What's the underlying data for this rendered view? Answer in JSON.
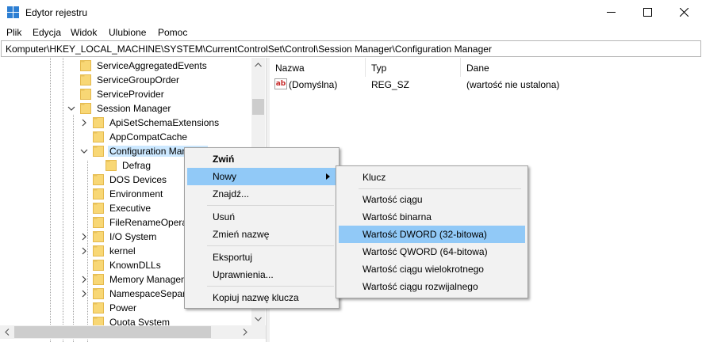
{
  "window": {
    "title": "Edytor rejestru",
    "controls": [
      "minimize",
      "maximize",
      "close"
    ]
  },
  "menubar": [
    "Plik",
    "Edycja",
    "Widok",
    "Ulubione",
    "Pomoc"
  ],
  "address": "Komputer\\HKEY_LOCAL_MACHINE\\SYSTEM\\CurrentControlSet\\Control\\Session Manager\\Configuration Manager",
  "tree": [
    {
      "label": "ServiceAggregatedEvents",
      "level": 0,
      "expander": "none"
    },
    {
      "label": "ServiceGroupOrder",
      "level": 0,
      "expander": "none"
    },
    {
      "label": "ServiceProvider",
      "level": 0,
      "expander": "none"
    },
    {
      "label": "Session Manager",
      "level": 0,
      "expander": "expanded"
    },
    {
      "label": "ApiSetSchemaExtensions",
      "level": 1,
      "expander": "collapsed"
    },
    {
      "label": "AppCompatCache",
      "level": 1,
      "expander": "none"
    },
    {
      "label": "Configuration Manager",
      "level": 1,
      "expander": "expanded",
      "selected": true
    },
    {
      "label": "Defrag",
      "level": 2,
      "expander": "none"
    },
    {
      "label": "DOS Devices",
      "level": 1,
      "expander": "none"
    },
    {
      "label": "Environment",
      "level": 1,
      "expander": "none"
    },
    {
      "label": "Executive",
      "level": 1,
      "expander": "none"
    },
    {
      "label": "FileRenameOperations",
      "level": 1,
      "expander": "none"
    },
    {
      "label": "I/O System",
      "level": 1,
      "expander": "collapsed"
    },
    {
      "label": "kernel",
      "level": 1,
      "expander": "collapsed"
    },
    {
      "label": "KnownDLLs",
      "level": 1,
      "expander": "none"
    },
    {
      "label": "Memory Management",
      "level": 1,
      "expander": "collapsed"
    },
    {
      "label": "NamespaceSeparation",
      "level": 1,
      "expander": "collapsed"
    },
    {
      "label": "Power",
      "level": 1,
      "expander": "none"
    },
    {
      "label": "Quota System",
      "level": 1,
      "expander": "none"
    }
  ],
  "list": {
    "columns": [
      "Nazwa",
      "Typ",
      "Dane"
    ],
    "rows": [
      {
        "name": "(Domyślna)",
        "type": "REG_SZ",
        "data": "(wartość nie ustalona)",
        "icon": "string-value-icon"
      }
    ]
  },
  "context_menu": {
    "items": [
      "Zwiń",
      "Nowy",
      "Znajdź...",
      "Usuń",
      "Zmień nazwę",
      "Eksportuj",
      "Uprawnienia...",
      "Kopiuj nazwę klucza"
    ],
    "highlighted": "Nowy"
  },
  "submenu": {
    "items": [
      "Klucz",
      "Wartość ciągu",
      "Wartość binarna",
      "Wartość DWORD (32-bitowa)",
      "Wartość QWORD (64-bitowa)",
      "Wartość ciągu wielokrotnego",
      "Wartość ciągu rozwijalnego"
    ],
    "highlighted": "Wartość DWORD (32-bitowa)"
  },
  "colors": {
    "highlight": "#91c9f7",
    "selection": "#cce8ff",
    "folder": "#f8d775",
    "menu_bg": "#f2f2f2"
  }
}
